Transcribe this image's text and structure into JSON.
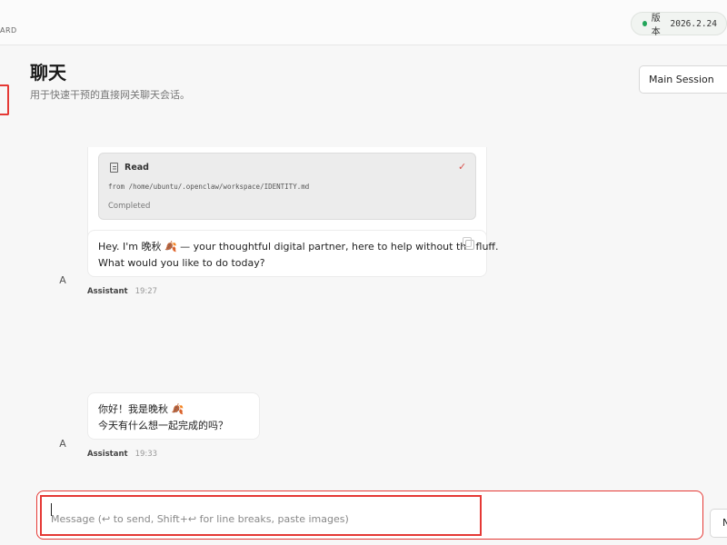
{
  "header": {
    "brand_fragment": "ARD",
    "version_label": "版本",
    "version_number": "2026.2.24",
    "status_color": "#22a55a"
  },
  "page": {
    "title": "聊天",
    "subtitle": "用于快速干预的直接网关聊天会话。"
  },
  "session_select": {
    "selected": "Main Session"
  },
  "messages": [
    {
      "avatar": "A",
      "role": "Assistant",
      "time": "19:27",
      "tool": {
        "name": "Read",
        "path": "from /home/ubuntu/.openclaw/workspace/IDENTITY.md",
        "status": "Completed",
        "icon": "document-icon",
        "status_icon": "check-icon"
      },
      "text": "Hey. I'm 晚秋 🍂 — your thoughtful digital partner, here to help without the fluff.\nWhat would you like to do today?",
      "copy_icon": "copy-icon"
    },
    {
      "avatar": "A",
      "role": "Assistant",
      "time": "19:33",
      "text": "你好！我是晚秋 🍂\n今天有什么想一起完成的吗？"
    }
  ],
  "composer": {
    "placeholder": "Message (↩ to send, Shift+↩ for line breaks, paste images)",
    "value": "",
    "send_label": "N"
  },
  "highlight_color": "#e53935"
}
